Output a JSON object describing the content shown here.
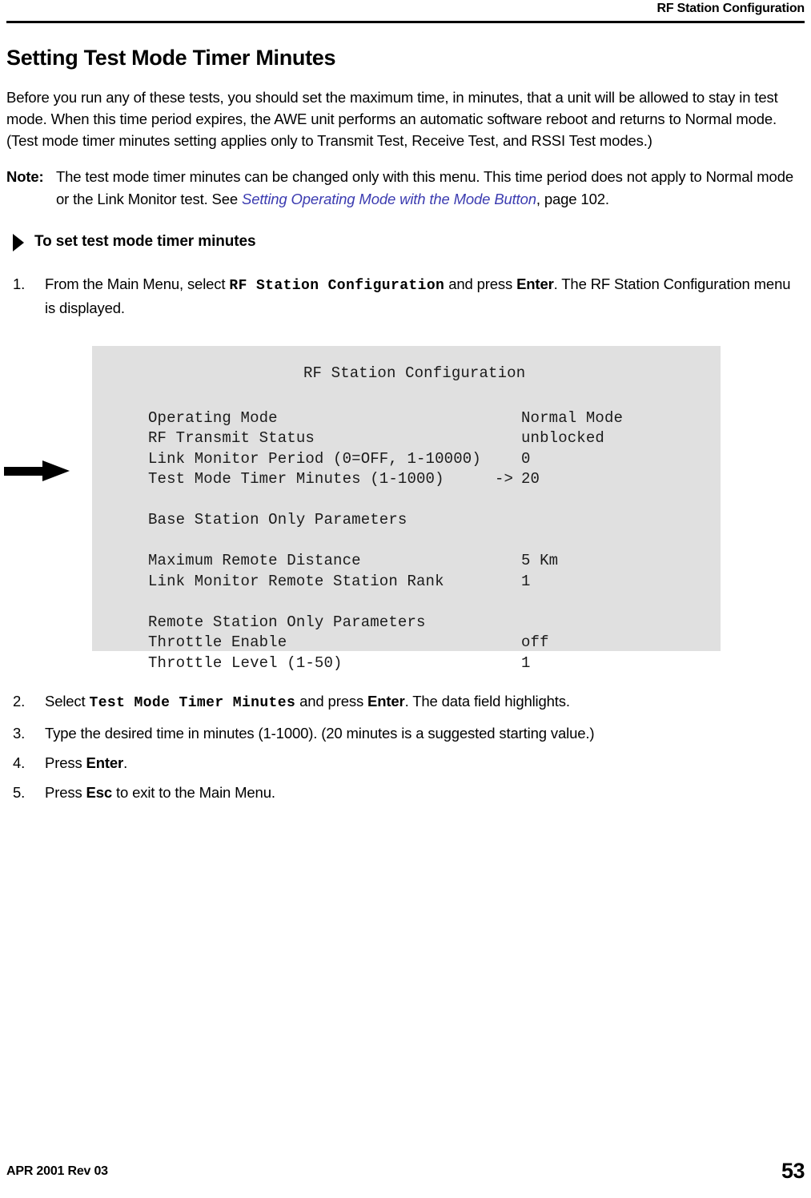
{
  "header": {
    "running_head": "RF Station Configuration"
  },
  "section": {
    "title": "Setting Test Mode Timer Minutes",
    "intro_paragraph": "Before you run any of these tests, you should set the maximum time, in minutes, that a unit will be allowed to stay in test mode. When this time period expires, the AWE unit performs an automatic software reboot and returns to Normal mode. (Test mode timer minutes setting applies only to Transmit Test, Receive Test, and RSSI Test modes.)"
  },
  "note": {
    "label": "Note:",
    "text_before_link": "The test mode timer minutes can be changed only with this menu. This time period does not apply to Normal mode or the Link Monitor test. See ",
    "link_text": "Setting Operating Mode with the Mode Button",
    "text_after_link": ", page 102."
  },
  "procedure": {
    "heading": "To set test mode timer minutes",
    "steps": [
      {
        "number": "1.",
        "part1": "From the Main Menu, select ",
        "code": "RF Station Configuration",
        "part2": " and press ",
        "key": "Enter",
        "part3": ". The RF Station Configuration menu is displayed."
      },
      {
        "number": "2.",
        "part1": "Select ",
        "code": "Test Mode Timer Minutes",
        "part2": " and press ",
        "key": "Enter",
        "part3": ". The data field highlights."
      },
      {
        "number": "3.",
        "part1": "Type the desired time in minutes (1-1000). (20 minutes is a suggested starting value.)",
        "code": "",
        "part2": "",
        "key": "",
        "part3": ""
      },
      {
        "number": "4.",
        "part1": "Press ",
        "code": "",
        "part2": "",
        "key": "Enter",
        "part3": "."
      },
      {
        "number": "5.",
        "part1": "Press ",
        "code": "",
        "part2": "",
        "key": "Esc",
        "part3": " to exit to the Main Menu."
      }
    ]
  },
  "terminal": {
    "title": "RF Station Configuration",
    "background_color": "#e0e0e0",
    "rows": [
      {
        "label": "Operating Mode",
        "marker": "",
        "value": "Normal Mode"
      },
      {
        "label": "RF Transmit Status",
        "marker": "",
        "value": "unblocked"
      },
      {
        "label": "Link Monitor Period (0=OFF, 1-10000)",
        "marker": "",
        "value": "0"
      },
      {
        "label": "Test Mode Timer Minutes (1-1000)",
        "marker": "->",
        "value": "20"
      },
      {
        "label": "",
        "marker": "",
        "value": ""
      },
      {
        "label": "Base Station Only Parameters",
        "marker": "",
        "value": ""
      },
      {
        "label": "",
        "marker": "",
        "value": ""
      },
      {
        "label": "Maximum Remote Distance",
        "marker": "",
        "value": "5 Km"
      },
      {
        "label": "Link Monitor Remote Station Rank",
        "marker": "",
        "value": "1"
      },
      {
        "label": "",
        "marker": "",
        "value": ""
      },
      {
        "label": "Remote Station Only Parameters",
        "marker": "",
        "value": ""
      },
      {
        "label": "Throttle Enable",
        "marker": "",
        "value": "off"
      },
      {
        "label": "Throttle Level (1-50)",
        "marker": "",
        "value": "1"
      }
    ],
    "pointer_target_row_index": 3
  },
  "footer": {
    "revision": "APR 2001 Rev 03",
    "page_number": "53"
  }
}
